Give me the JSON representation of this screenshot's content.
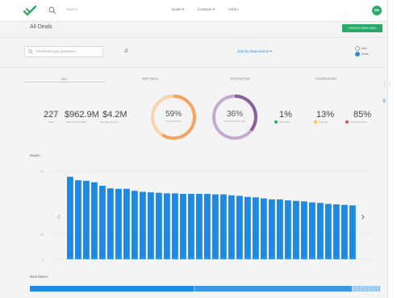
{
  "nav": {
    "search_placeholder": "Search",
    "items": [
      {
        "label": "Deals ▾"
      },
      {
        "label": "Contacts ▾"
      },
      {
        "label": "Admin"
      }
    ],
    "avatar_initials": "GE"
  },
  "header": {
    "title": "All Deals",
    "create_button": "CREATE NEW DEAL"
  },
  "filter": {
    "pipeline_placeholder": "Find/Add your pipelines...",
    "sort_label": "Sort by deal source ▾",
    "radio_options": [
      {
        "label": "Add",
        "selected": false
      },
      {
        "label": "Stats",
        "selected": true
      }
    ]
  },
  "tabs": [
    {
      "label": "ALL",
      "active": true
    },
    {
      "label": "NOT DEAL"
    },
    {
      "label": "STAGNATED"
    },
    {
      "label": "COMPLETED"
    }
  ],
  "stats": {
    "deals_count": "227",
    "deals_label": "deals",
    "total_value": "$962.9M",
    "total_value_label": "Total current Value",
    "avg_value": "$4.2M",
    "avg_value_label": "Avg deal amount",
    "donut1_value": "59%",
    "donut1_fraction": 0.59,
    "donut1_label": "Avg profit rate",
    "donut1_color": "#f4a460",
    "donut2_value": "36%",
    "donut2_fraction": 0.36,
    "donut2_label": "Win/Lost close rate",
    "donut2_color": "#8b5f9f",
    "pct1_value": "1%",
    "pct1_label": "New deals",
    "pct1_color": "#2daa6b",
    "pct2_value": "13%",
    "pct2_label": "On track",
    "pct2_color": "#f5c542",
    "pct3_value": "85%",
    "pct3_label": "Delays/Overdue",
    "pct3_color": "#d9534f"
  },
  "chart_section": {
    "title": "Deals:",
    "deal_owner_label": "Deal Owner:"
  },
  "chart_data": {
    "type": "bar",
    "title": "Deals:",
    "color": "#1e88e5",
    "ylim": [
      0,
      175
    ],
    "yticks": [
      "0",
      "50",
      "175"
    ],
    "yticks_values": [
      0,
      50,
      175
    ],
    "values": [
      164,
      157,
      156,
      153,
      146,
      141,
      140,
      140,
      136,
      134,
      133,
      132,
      131,
      131,
      130,
      130,
      130,
      130,
      129,
      129,
      127,
      126,
      124,
      123,
      121,
      119,
      119,
      117,
      116,
      115,
      113,
      112,
      110,
      109,
      108,
      107
    ],
    "grid": true,
    "nav_left": "‹",
    "nav_right": "›"
  },
  "owner_bar_data": {
    "segments": [
      {
        "fraction": 0.47,
        "color": "#1e88e5"
      },
      {
        "fraction": 0.45,
        "color": "#3d95e6"
      },
      {
        "fraction": 0.08,
        "color": "#8cc3f0"
      }
    ]
  },
  "icons": {
    "logo": "handshake-logo-icon",
    "search": "search-icon",
    "filter": "filter-icon",
    "grid": "grid-icon",
    "settings": "settings-icon"
  }
}
